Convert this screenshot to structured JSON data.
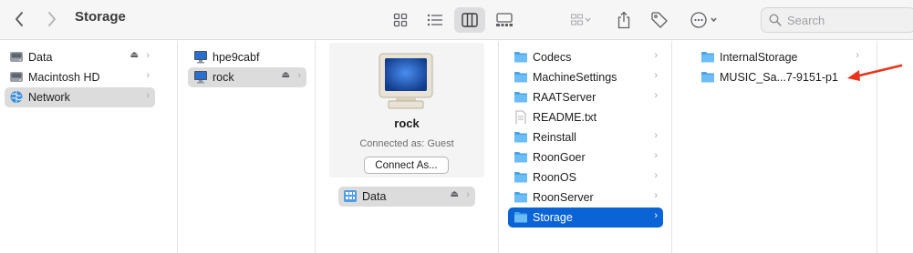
{
  "window": {
    "title": "Storage"
  },
  "toolbar": {
    "search_placeholder": "Search",
    "view_modes": [
      "icon-view",
      "list-view",
      "column-view",
      "gallery-view"
    ],
    "active_view": "column-view"
  },
  "sidebar": {
    "items": [
      {
        "label": "Data",
        "icon": "drive-icon",
        "eject": true
      },
      {
        "label": "Macintosh HD",
        "icon": "drive-icon",
        "eject": false
      },
      {
        "label": "Network",
        "icon": "network-globe-icon",
        "eject": false,
        "selected": true
      }
    ]
  },
  "network_column": {
    "items": [
      {
        "label": "hpe9cabf",
        "icon": "monitor-icon",
        "eject": false
      },
      {
        "label": "rock",
        "icon": "monitor-icon",
        "eject": true,
        "selected": true
      }
    ]
  },
  "server_detail": {
    "name": "rock",
    "status": "Connected as: Guest",
    "connect_label": "Connect As...",
    "shares": [
      {
        "label": "Data",
        "icon": "shared-volume-icon",
        "eject": true,
        "selected": true
      }
    ]
  },
  "data_column": {
    "items": [
      {
        "label": "Codecs",
        "type": "folder"
      },
      {
        "label": "MachineSettings",
        "type": "folder"
      },
      {
        "label": "RAATServer",
        "type": "folder"
      },
      {
        "label": "README.txt",
        "type": "file"
      },
      {
        "label": "Reinstall",
        "type": "folder"
      },
      {
        "label": "RoonGoer",
        "type": "folder"
      },
      {
        "label": "RoonOS",
        "type": "folder"
      },
      {
        "label": "RoonServer",
        "type": "folder"
      },
      {
        "label": "Storage",
        "type": "folder",
        "selected": true
      }
    ]
  },
  "storage_column": {
    "items": [
      {
        "label": "InternalStorage",
        "type": "folder"
      },
      {
        "label": "MUSIC_Sa...7-9151-p1",
        "type": "folder"
      }
    ]
  },
  "colors": {
    "selection_blue": "#0a64d6",
    "folder_blue": "#5fb4f0",
    "annotation_arrow": "#e8341c"
  }
}
